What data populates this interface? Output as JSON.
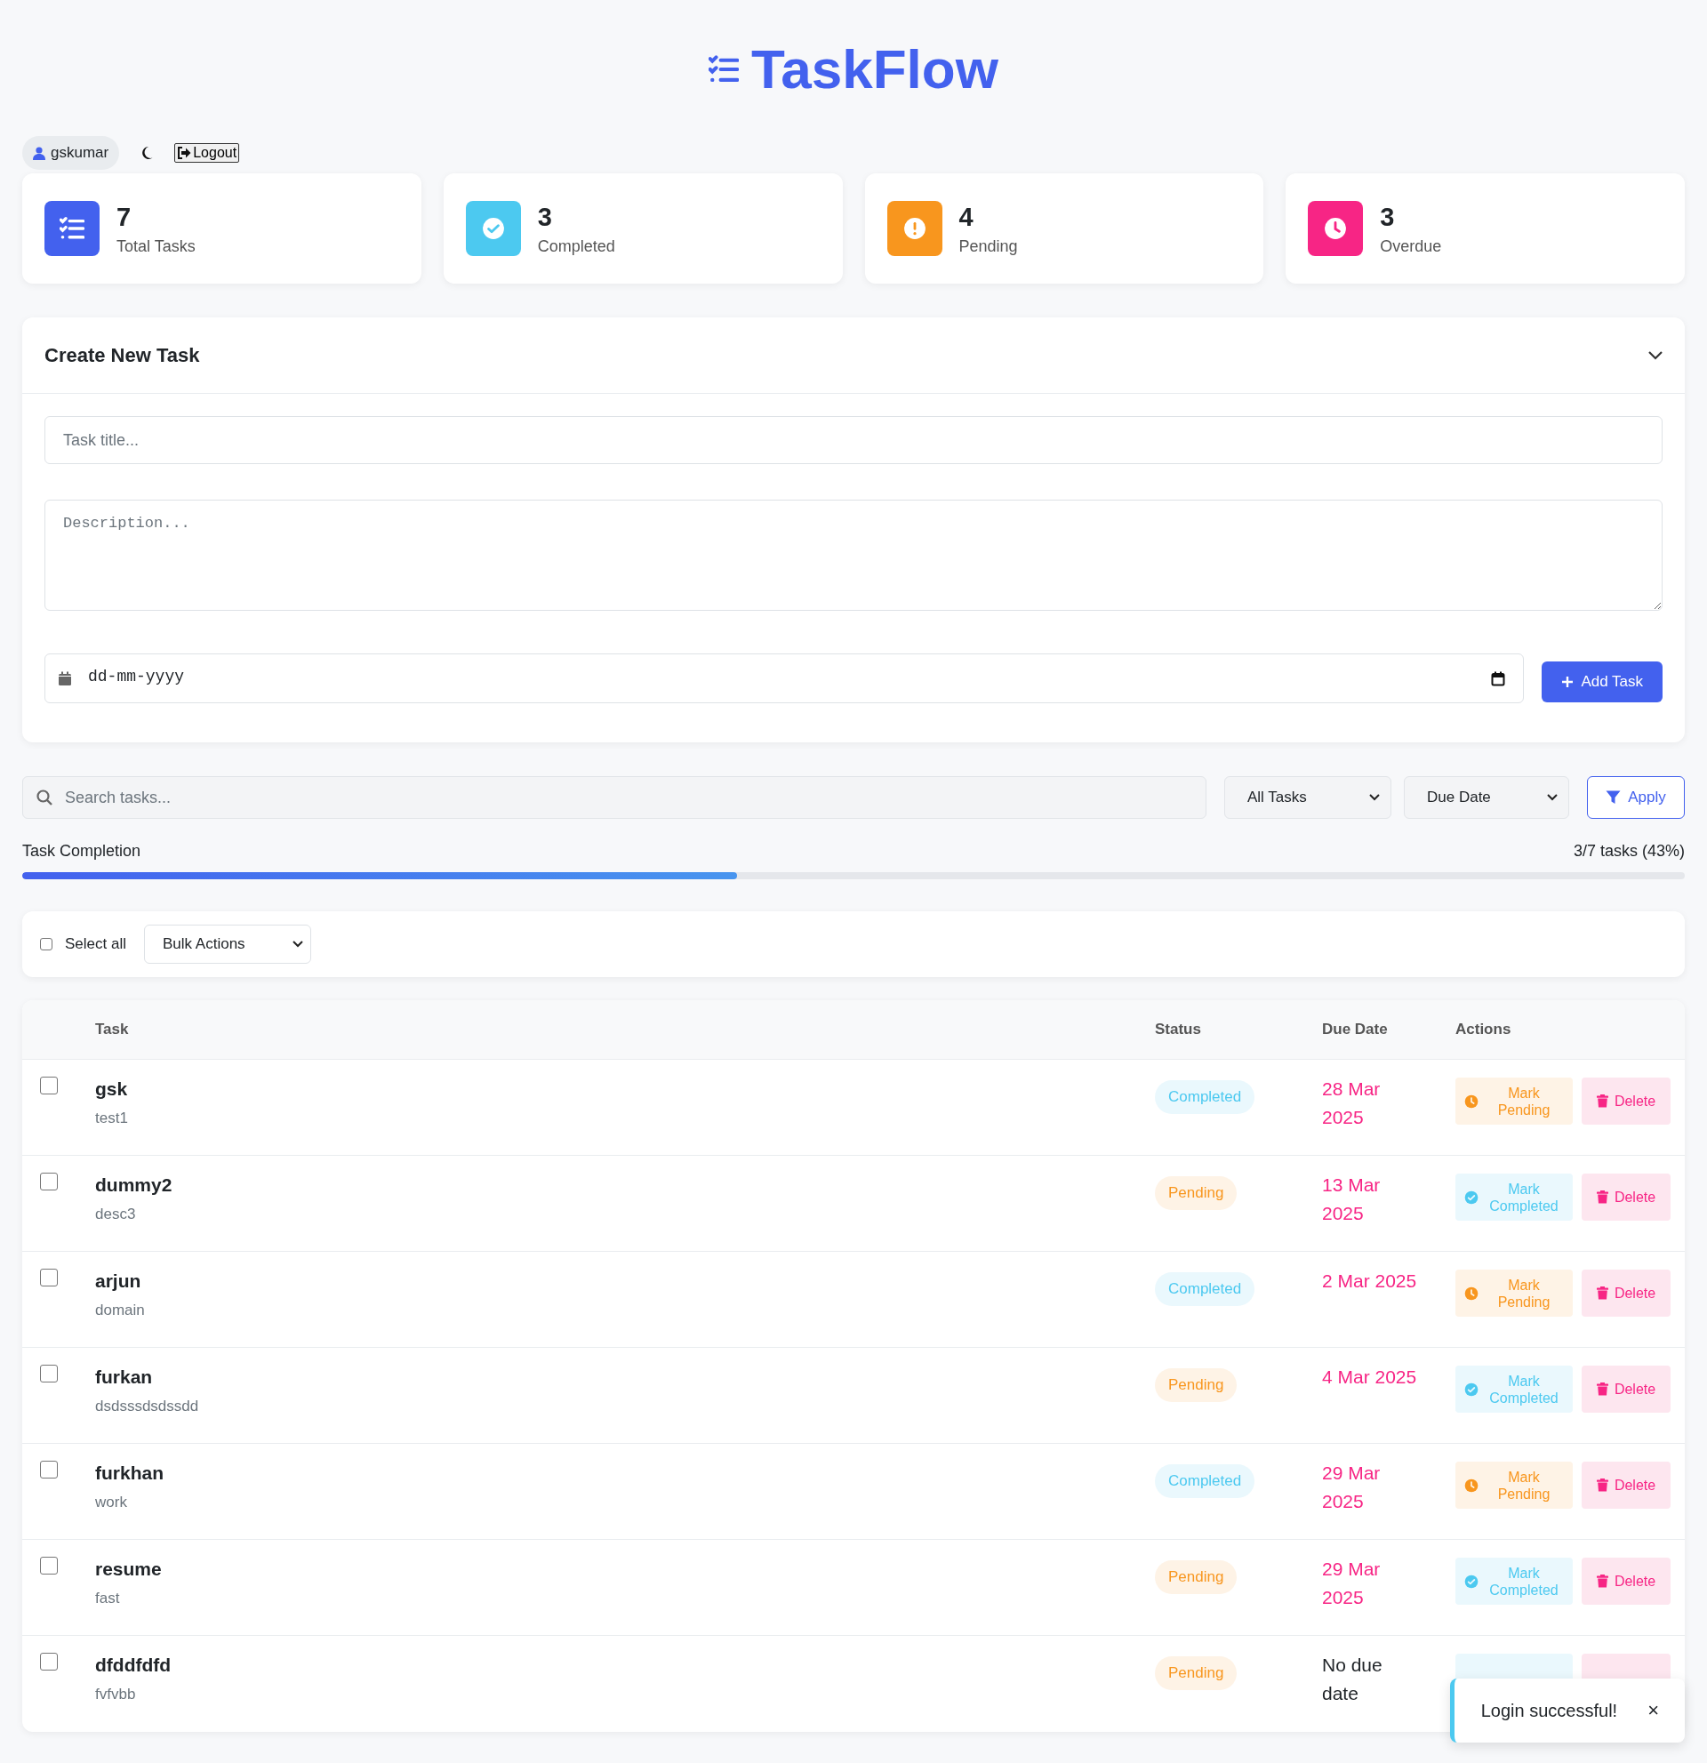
{
  "app": {
    "title": "TaskFlow"
  },
  "user": {
    "name": "gskumar",
    "logout": "Logout"
  },
  "stats": [
    {
      "kind": "total",
      "value": "7",
      "label": "Total Tasks"
    },
    {
      "kind": "completed",
      "value": "3",
      "label": "Completed"
    },
    {
      "kind": "pending",
      "value": "4",
      "label": "Pending"
    },
    {
      "kind": "overdue",
      "value": "3",
      "label": "Overdue"
    }
  ],
  "create": {
    "title": "Create New Task",
    "expanded": true,
    "title_placeholder": "Task title...",
    "description_placeholder": "Description...",
    "date_placeholder": "dd-mm-yyyy",
    "add_button": "Add Task"
  },
  "filters": {
    "search_placeholder": "Search tasks...",
    "status_filter": "All Tasks",
    "sort": "Due Date",
    "apply": "Apply"
  },
  "completion": {
    "label": "Task Completion",
    "reading": "3/7 tasks (43%)",
    "level": 0.43
  },
  "bulk": {
    "select_all": "Select all",
    "checked": false,
    "action": "Bulk Actions"
  },
  "table": {
    "columns": [
      "Task",
      "Status",
      "Due Date",
      "Actions"
    ],
    "rows": [
      {
        "title": "gsk",
        "description": "test1",
        "checked": false,
        "status": {
          "kind": "completed",
          "label": "Completed"
        },
        "due": "28 Mar 2025",
        "overdue": true,
        "action": {
          "kind": "pending",
          "label": "Mark Pending"
        },
        "delete": "Delete"
      },
      {
        "title": "dummy2",
        "description": "desc3",
        "checked": false,
        "status": {
          "kind": "pending",
          "label": "Pending"
        },
        "due": "13 Mar 2025",
        "overdue": true,
        "action": {
          "kind": "completed",
          "label": "Mark Completed"
        },
        "delete": "Delete"
      },
      {
        "title": "arjun",
        "description": "domain",
        "checked": false,
        "status": {
          "kind": "completed",
          "label": "Completed"
        },
        "due": "2 Mar 2025",
        "overdue": true,
        "action": {
          "kind": "pending",
          "label": "Mark Pending"
        },
        "delete": "Delete"
      },
      {
        "title": "furkan",
        "description": "dsdsssdsdssdd",
        "checked": false,
        "status": {
          "kind": "pending",
          "label": "Pending"
        },
        "due": "4 Mar 2025",
        "overdue": true,
        "action": {
          "kind": "completed",
          "label": "Mark Completed"
        },
        "delete": "Delete"
      },
      {
        "title": "furkhan",
        "description": "work",
        "checked": false,
        "status": {
          "kind": "completed",
          "label": "Completed"
        },
        "due": "29 Mar 2025",
        "overdue": true,
        "action": {
          "kind": "pending",
          "label": "Mark Pending"
        },
        "delete": "Delete"
      },
      {
        "title": "resume",
        "description": "fast",
        "checked": false,
        "status": {
          "kind": "pending",
          "label": "Pending"
        },
        "due": "29 Mar 2025",
        "overdue": true,
        "action": {
          "kind": "completed",
          "label": "Mark Completed"
        },
        "delete": "Delete"
      },
      {
        "title": "dfddfdfd",
        "description": "fvfvbb",
        "checked": false,
        "status": {
          "kind": "pending",
          "label": "Pending"
        },
        "due": "No due date",
        "overdue": false,
        "action": {
          "kind": "completed"
        }
      }
    ]
  },
  "toast": {
    "message": "Login successful!",
    "close": "×"
  }
}
